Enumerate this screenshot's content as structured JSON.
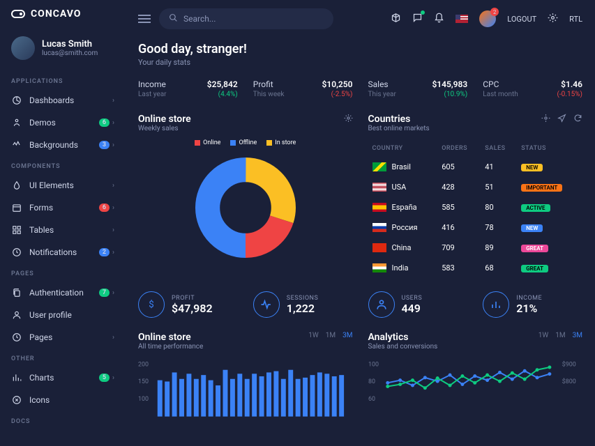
{
  "brand": "CONCAVO",
  "user": {
    "name": "Lucas Smith",
    "email": "lucas@smith.com"
  },
  "nav": {
    "applications": "APPLICATIONS",
    "dashboards": "Dashboards",
    "demos": "Demos",
    "demos_badge": "6",
    "backgrounds": "Backgrounds",
    "backgrounds_badge": "3",
    "components": "COMPONENTS",
    "uielements": "UI Elements",
    "forms": "Forms",
    "forms_badge": "6",
    "tables": "Tables",
    "notifications": "Notifications",
    "notifications_badge": "2",
    "pages": "PAGES",
    "authentication": "Authentication",
    "auth_badge": "7",
    "userprofile": "User profile",
    "pages_item": "Pages",
    "other": "OTHER",
    "charts": "Charts",
    "charts_badge": "5",
    "icons": "Icons",
    "docs": "DOCS"
  },
  "topbar": {
    "search_placeholder": "Search...",
    "logout": "LOGOUT",
    "rtl": "RTL"
  },
  "greeting": {
    "title": "Good day, stranger!",
    "subtitle": "Your daily stats"
  },
  "stats": [
    {
      "label": "Income",
      "value": "$25,842",
      "sub": "Last year",
      "pct": "(4.4%)",
      "neg": false
    },
    {
      "label": "Profit",
      "value": "$10,250",
      "sub": "This week",
      "pct": "(-2.5%)",
      "neg": true
    },
    {
      "label": "Sales",
      "value": "$145,983",
      "sub": "This year",
      "pct": "(10.9%)",
      "neg": false
    },
    {
      "label": "CPC",
      "value": "$1.46",
      "sub": "Last month",
      "pct": "(-0.15%)",
      "neg": true
    }
  ],
  "online_store": {
    "title": "Online store",
    "subtitle": "Weekly sales",
    "legend": [
      "Online",
      "Offline",
      "In store"
    ]
  },
  "countries": {
    "title": "Countries",
    "subtitle": "Best online markets",
    "headers": {
      "country": "COUNTRY",
      "orders": "ORDERS",
      "sales": "SALES",
      "status": "STATUS"
    },
    "rows": [
      {
        "name": "Brasil",
        "orders": "605",
        "sales": "41",
        "status": "NEW",
        "pill": "yellow",
        "flag": "br"
      },
      {
        "name": "USA",
        "orders": "428",
        "sales": "51",
        "status": "IMPORTANT",
        "pill": "orange",
        "flag": "us"
      },
      {
        "name": "España",
        "orders": "585",
        "sales": "80",
        "status": "ACTIVE",
        "pill": "green",
        "flag": "es"
      },
      {
        "name": "Россия",
        "orders": "416",
        "sales": "78",
        "status": "NEW",
        "pill": "blue",
        "flag": "ru"
      },
      {
        "name": "China",
        "orders": "709",
        "sales": "89",
        "status": "GREAT",
        "pill": "pink",
        "flag": "cn"
      },
      {
        "name": "India",
        "orders": "583",
        "sales": "68",
        "status": "GREAT",
        "pill": "green",
        "flag": "in"
      }
    ]
  },
  "metrics": [
    {
      "label": "PROFIT",
      "value": "$47,982",
      "icon": "dollar"
    },
    {
      "label": "SESSIONS",
      "value": "1,222",
      "icon": "pulse"
    },
    {
      "label": "USERS",
      "value": "449",
      "icon": "user"
    },
    {
      "label": "INCOME",
      "value": "21%",
      "icon": "bars"
    }
  ],
  "bottom_charts": {
    "store": {
      "title": "Online store",
      "subtitle": "All time performance"
    },
    "analytics": {
      "title": "Analytics",
      "subtitle": "Sales and conversions"
    },
    "tabs": [
      "1W",
      "1M",
      "3M"
    ]
  },
  "chart_data": [
    {
      "type": "pie",
      "title": "Online store weekly sales",
      "series": [
        {
          "name": "Online",
          "value": 20,
          "color": "#ef4444"
        },
        {
          "name": "Offline",
          "value": 50,
          "color": "#3b82f6"
        },
        {
          "name": "In store",
          "value": 30,
          "color": "#fbbf24"
        }
      ]
    },
    {
      "type": "bar",
      "title": "Online store all time performance",
      "ylim": [
        0,
        200
      ],
      "yticks": [
        100,
        150,
        200
      ],
      "values": [
        140,
        135,
        170,
        145,
        165,
        145,
        160,
        140,
        120,
        180,
        145,
        165,
        145,
        165,
        155,
        170,
        175,
        145,
        180,
        145,
        150,
        160,
        170,
        165,
        155,
        160
      ],
      "color": "#3b82f6"
    },
    {
      "type": "line",
      "title": "Analytics sales and conversions",
      "ylim": [
        0,
        100
      ],
      "y2lim": [
        0,
        900
      ],
      "yticks": [
        60,
        80,
        100
      ],
      "y2ticks": [
        "$800",
        "$900"
      ],
      "series": [
        {
          "name": "A",
          "color": "#3b82f6",
          "values": [
            65,
            70,
            60,
            75,
            68,
            80,
            62,
            78,
            70,
            85,
            72,
            88,
            75,
            82
          ]
        },
        {
          "name": "B",
          "color": "#0ecb81",
          "values": [
            58,
            62,
            70,
            55,
            74,
            60,
            78,
            65,
            80,
            68,
            84,
            72,
            90,
            95
          ]
        }
      ]
    }
  ]
}
